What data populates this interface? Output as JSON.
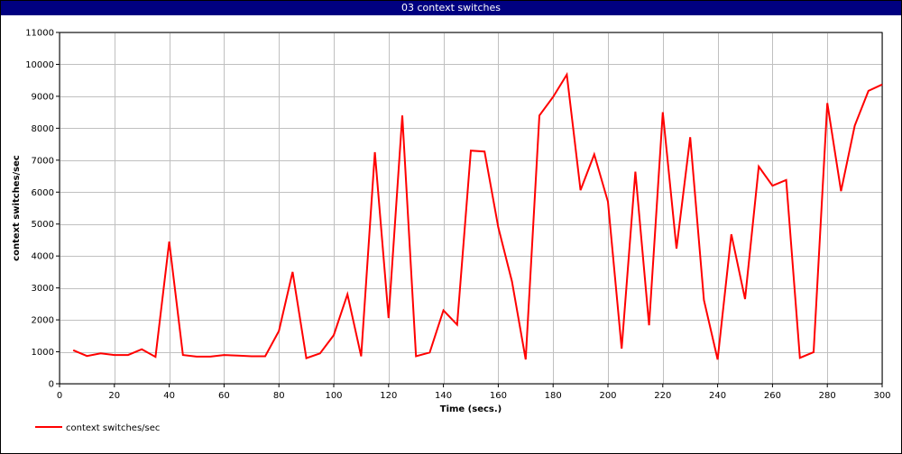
{
  "window": {
    "title": "03 context switches"
  },
  "colors": {
    "series": "#ff0000",
    "grid": "#c0c0c0",
    "title_bar": "#000080"
  },
  "chart_data": {
    "type": "line",
    "title": "03 context switches",
    "xlabel": "Time (secs.)",
    "ylabel": "context switches/sec",
    "xlim": [
      0,
      300
    ],
    "ylim": [
      0,
      11000
    ],
    "xticks": [
      0,
      20,
      40,
      60,
      80,
      100,
      120,
      140,
      160,
      180,
      200,
      220,
      240,
      260,
      280,
      300
    ],
    "yticks": [
      0,
      1000,
      2000,
      3000,
      4000,
      5000,
      6000,
      7000,
      8000,
      9000,
      10000,
      11000
    ],
    "grid": true,
    "legend": "bottom-left",
    "series": [
      {
        "name": "context switches/sec",
        "color": "#ff0000",
        "x": [
          5,
          10,
          15,
          20,
          25,
          30,
          35,
          40,
          45,
          50,
          55,
          60,
          65,
          70,
          75,
          80,
          85,
          90,
          95,
          100,
          105,
          110,
          115,
          120,
          125,
          130,
          135,
          140,
          145,
          150,
          155,
          160,
          165,
          170,
          175,
          180,
          185,
          190,
          195,
          200,
          205,
          210,
          215,
          220,
          225,
          230,
          235,
          240,
          245,
          250,
          255,
          260,
          265,
          270,
          275,
          280,
          285,
          290,
          295,
          300
        ],
        "y": [
          1050,
          870,
          950,
          900,
          900,
          1080,
          840,
          4450,
          900,
          850,
          850,
          900,
          880,
          860,
          860,
          1650,
          3500,
          800,
          950,
          1520,
          2800,
          860,
          7250,
          2060,
          8400,
          860,
          980,
          2300,
          1850,
          7300,
          7270,
          4900,
          3200,
          760,
          8400,
          8980,
          9680,
          6060,
          7180,
          5700,
          1100,
          6640,
          1830,
          8500,
          4230,
          7720,
          2620,
          760,
          4680,
          2650,
          6800,
          6200,
          6380,
          810,
          990,
          8790,
          6030,
          8080,
          9170,
          9370
        ]
      }
    ]
  }
}
